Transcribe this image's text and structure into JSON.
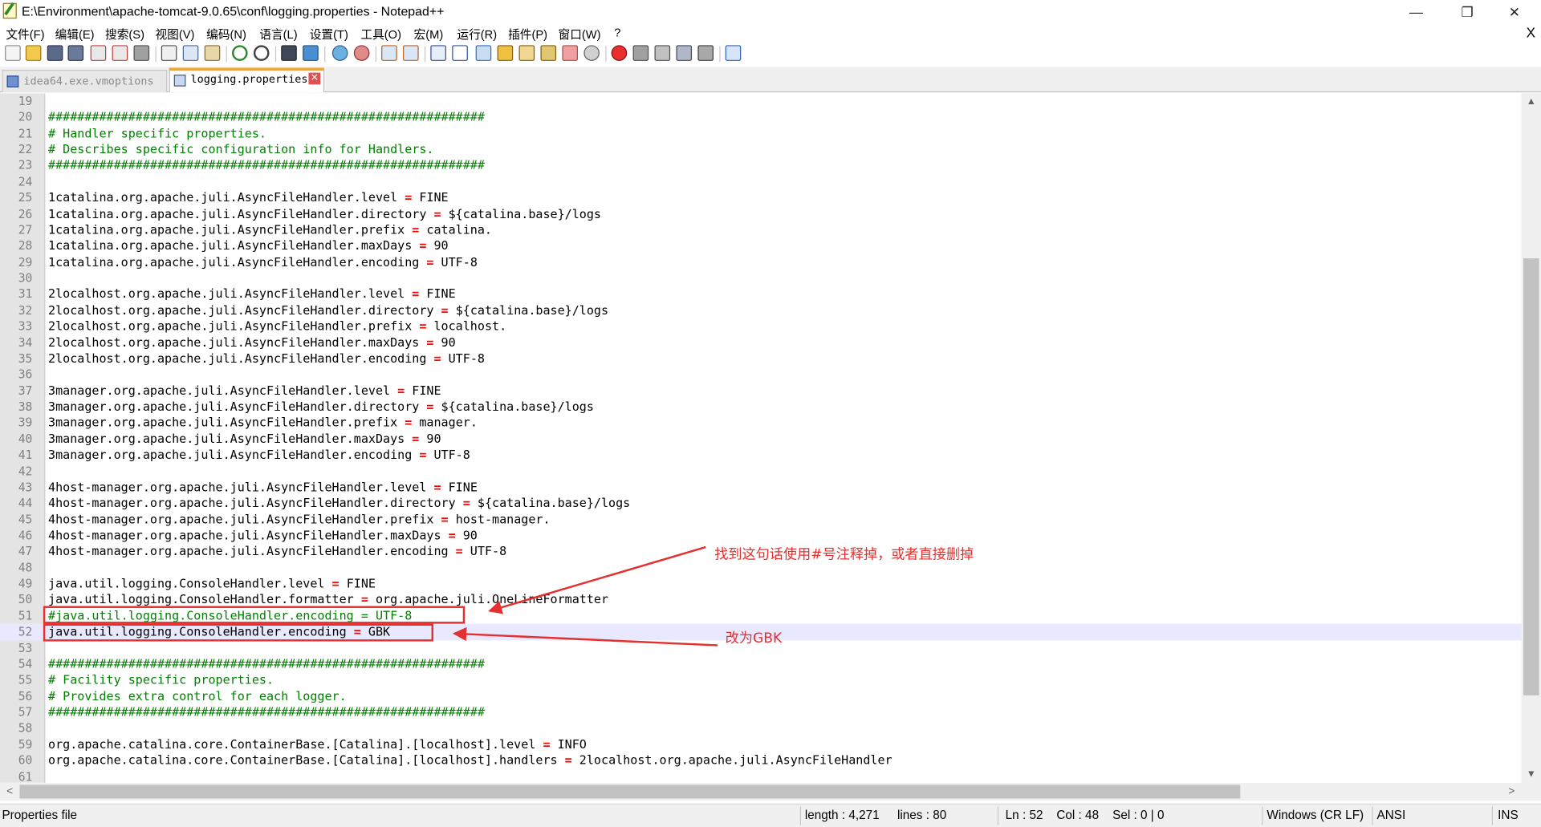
{
  "window": {
    "title": "E:\\Environment\\apache-tomcat-9.0.65\\conf\\logging.properties - Notepad++",
    "minimize": "—",
    "maximize": "❐",
    "close": "✕"
  },
  "menu": {
    "items": [
      "文件(F)",
      "编辑(E)",
      "搜索(S)",
      "视图(V)",
      "编码(N)",
      "语言(L)",
      "设置(T)",
      "工具(O)",
      "宏(M)",
      "运行(R)",
      "插件(P)",
      "窗口(W)",
      "?"
    ],
    "close_doc": "X"
  },
  "tabs": [
    {
      "label": "idea64.exe.vmoptions",
      "active": false
    },
    {
      "label": "logging.properties",
      "active": true,
      "close": "✕"
    }
  ],
  "editor": {
    "current_line": 52,
    "lines": [
      {
        "n": "19",
        "t": "blank",
        "text": ""
      },
      {
        "n": "20",
        "t": "comment",
        "text": "############################################################"
      },
      {
        "n": "21",
        "t": "comment",
        "text": "# Handler specific properties."
      },
      {
        "n": "22",
        "t": "comment",
        "text": "# Describes specific configuration info for Handlers."
      },
      {
        "n": "23",
        "t": "comment",
        "text": "############################################################"
      },
      {
        "n": "24",
        "t": "blank",
        "text": ""
      },
      {
        "n": "25",
        "t": "kv",
        "key": "1catalina.org.apache.juli.AsyncFileHandler.level",
        "val": "FINE"
      },
      {
        "n": "26",
        "t": "kv",
        "key": "1catalina.org.apache.juli.AsyncFileHandler.directory",
        "val": "${catalina.base}/logs"
      },
      {
        "n": "27",
        "t": "kv",
        "key": "1catalina.org.apache.juli.AsyncFileHandler.prefix",
        "val": "catalina."
      },
      {
        "n": "28",
        "t": "kv",
        "key": "1catalina.org.apache.juli.AsyncFileHandler.maxDays",
        "val": "90"
      },
      {
        "n": "29",
        "t": "kv",
        "key": "1catalina.org.apache.juli.AsyncFileHandler.encoding",
        "val": "UTF-8"
      },
      {
        "n": "30",
        "t": "blank",
        "text": ""
      },
      {
        "n": "31",
        "t": "kv",
        "key": "2localhost.org.apache.juli.AsyncFileHandler.level",
        "val": "FINE"
      },
      {
        "n": "32",
        "t": "kv",
        "key": "2localhost.org.apache.juli.AsyncFileHandler.directory",
        "val": "${catalina.base}/logs"
      },
      {
        "n": "33",
        "t": "kv",
        "key": "2localhost.org.apache.juli.AsyncFileHandler.prefix",
        "val": "localhost."
      },
      {
        "n": "34",
        "t": "kv",
        "key": "2localhost.org.apache.juli.AsyncFileHandler.maxDays",
        "val": "90"
      },
      {
        "n": "35",
        "t": "kv",
        "key": "2localhost.org.apache.juli.AsyncFileHandler.encoding",
        "val": "UTF-8"
      },
      {
        "n": "36",
        "t": "blank",
        "text": ""
      },
      {
        "n": "37",
        "t": "kv",
        "key": "3manager.org.apache.juli.AsyncFileHandler.level",
        "val": "FINE"
      },
      {
        "n": "38",
        "t": "kv",
        "key": "3manager.org.apache.juli.AsyncFileHandler.directory",
        "val": "${catalina.base}/logs"
      },
      {
        "n": "39",
        "t": "kv",
        "key": "3manager.org.apache.juli.AsyncFileHandler.prefix",
        "val": "manager."
      },
      {
        "n": "40",
        "t": "kv",
        "key": "3manager.org.apache.juli.AsyncFileHandler.maxDays",
        "val": "90"
      },
      {
        "n": "41",
        "t": "kv",
        "key": "3manager.org.apache.juli.AsyncFileHandler.encoding",
        "val": "UTF-8"
      },
      {
        "n": "42",
        "t": "blank",
        "text": ""
      },
      {
        "n": "43",
        "t": "kv",
        "key": "4host-manager.org.apache.juli.AsyncFileHandler.level",
        "val": "FINE"
      },
      {
        "n": "44",
        "t": "kv",
        "key": "4host-manager.org.apache.juli.AsyncFileHandler.directory",
        "val": "${catalina.base}/logs"
      },
      {
        "n": "45",
        "t": "kv",
        "key": "4host-manager.org.apache.juli.AsyncFileHandler.prefix",
        "val": "host-manager."
      },
      {
        "n": "46",
        "t": "kv",
        "key": "4host-manager.org.apache.juli.AsyncFileHandler.maxDays",
        "val": "90"
      },
      {
        "n": "47",
        "t": "kv",
        "key": "4host-manager.org.apache.juli.AsyncFileHandler.encoding",
        "val": "UTF-8"
      },
      {
        "n": "48",
        "t": "blank",
        "text": ""
      },
      {
        "n": "49",
        "t": "kv",
        "key": "java.util.logging.ConsoleHandler.level",
        "val": "FINE"
      },
      {
        "n": "50",
        "t": "kv",
        "key": "java.util.logging.ConsoleHandler.formatter",
        "val": "org.apache.juli.OneLineFormatter"
      },
      {
        "n": "51",
        "t": "comment",
        "text": "#java.util.logging.ConsoleHandler.encoding = UTF-8"
      },
      {
        "n": "52",
        "t": "kv",
        "key": "java.util.logging.ConsoleHandler.encoding",
        "val": "GBK"
      },
      {
        "n": "53",
        "t": "blank",
        "text": ""
      },
      {
        "n": "54",
        "t": "comment",
        "text": "############################################################"
      },
      {
        "n": "55",
        "t": "comment",
        "text": "# Facility specific properties."
      },
      {
        "n": "56",
        "t": "comment",
        "text": "# Provides extra control for each logger."
      },
      {
        "n": "57",
        "t": "comment",
        "text": "############################################################"
      },
      {
        "n": "58",
        "t": "blank",
        "text": ""
      },
      {
        "n": "59",
        "t": "kv",
        "key": "org.apache.catalina.core.ContainerBase.[Catalina].[localhost].level",
        "val": "INFO"
      },
      {
        "n": "60",
        "t": "kv",
        "key": "org.apache.catalina.core.ContainerBase.[Catalina].[localhost].handlers",
        "val": "2localhost.org.apache.juli.AsyncFileHandler"
      },
      {
        "n": "61",
        "t": "blank",
        "text": ""
      }
    ]
  },
  "annotations": {
    "note_comment_out": "找到这句话使用#号注释掉，或者直接删掉",
    "note_change_gbk": "改为GBK"
  },
  "status": {
    "file_type": "Properties file",
    "length": "length : 4,271",
    "lines": "lines : 80",
    "ln": "Ln : 52",
    "col": "Col : 48",
    "sel": "Sel : 0 | 0",
    "eol": "Windows (CR LF)",
    "encoding": "ANSI",
    "mode": "INS"
  },
  "colors": {
    "comment": "#008000",
    "operator": "#ff0000",
    "annotation": "#e53030",
    "current_line": "#e8e8ff",
    "active_tab_accent": "#f5a623"
  }
}
